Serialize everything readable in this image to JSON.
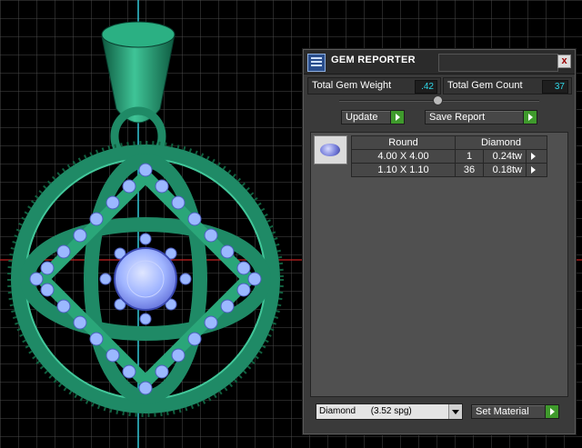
{
  "panel": {
    "title": "GEM REPORTER",
    "close_glyph": "x",
    "total_weight_label": "Total Gem Weight",
    "total_weight_value": ".42",
    "total_count_label": "Total Gem Count",
    "total_count_value": "37",
    "update_label": "Update",
    "save_report_label": "Save Report",
    "report": {
      "header_shape": "Round",
      "header_material": "Diamond",
      "rows": [
        {
          "size": "4.00 X 4.00",
          "qty": "1",
          "weight": "0.24tw"
        },
        {
          "size": "1.10 X 1.10",
          "qty": "36",
          "weight": "0.18tw"
        }
      ]
    },
    "material_select": "Diamond      (3.52 spg)",
    "set_material_label": "Set Material"
  },
  "colors": {
    "metal": "#1f8a66",
    "gem": "#9bb8ff",
    "accent_value": "#2fd8e8",
    "go_button": "#3f9a2c"
  },
  "icons": {
    "app": "gem-reporter-app-icon",
    "gem": "round-gem-icon",
    "go": "play-arrow-icon"
  }
}
